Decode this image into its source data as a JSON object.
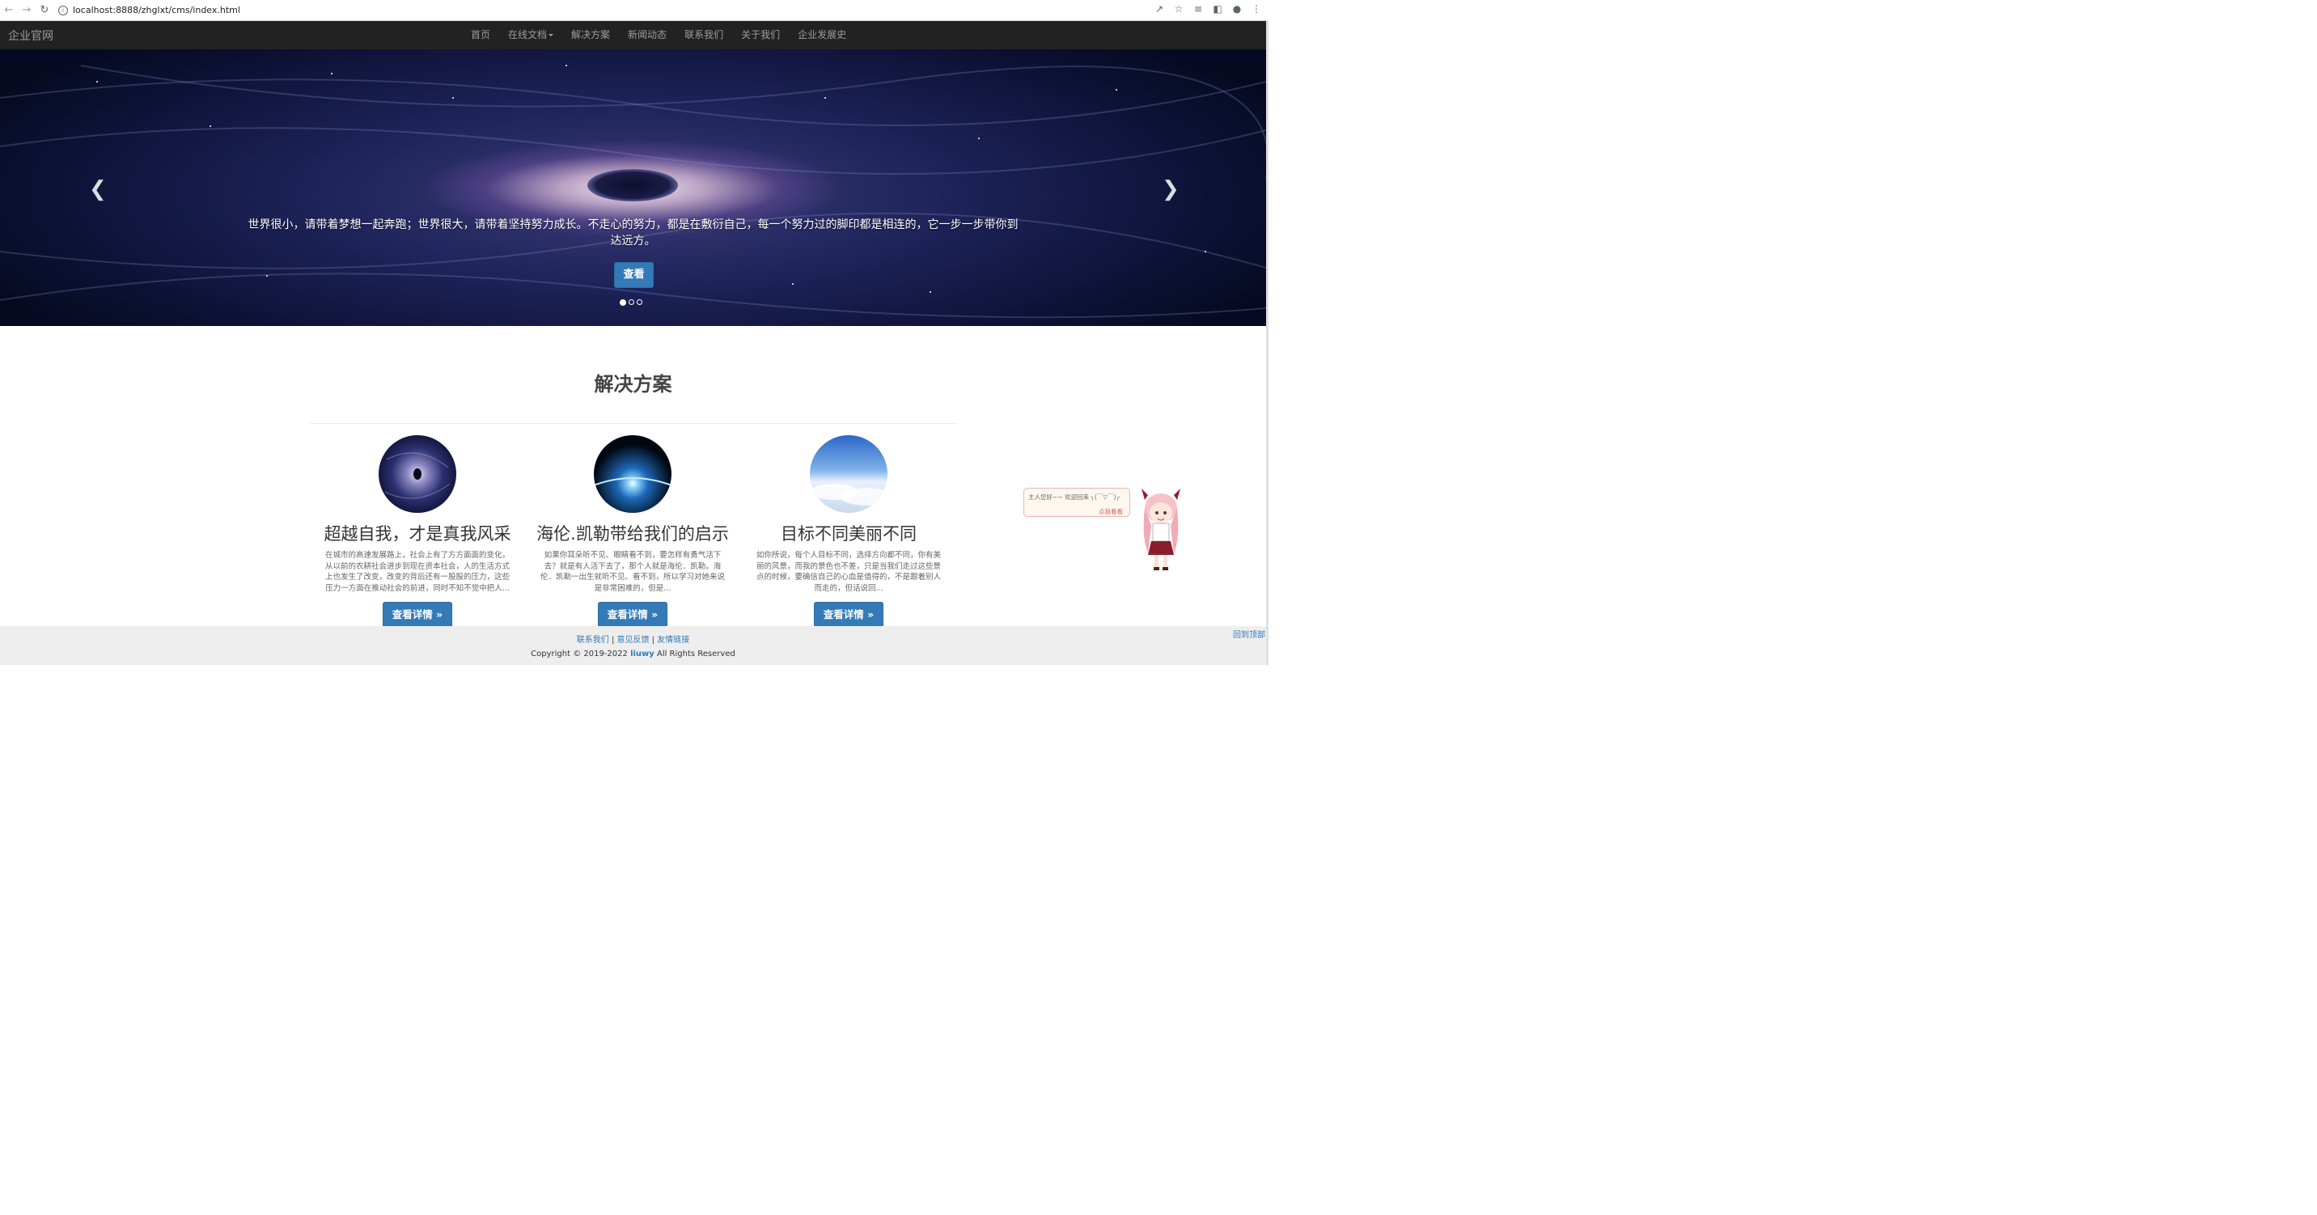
{
  "browser": {
    "url": "localhost:8888/zhglxt/cms/index.html"
  },
  "navbar": {
    "brand": "企业官网",
    "items": [
      {
        "label": "首页"
      },
      {
        "label": "在线文档"
      },
      {
        "label": "解决方案"
      },
      {
        "label": "新闻动态"
      },
      {
        "label": "联系我们"
      },
      {
        "label": "关于我们"
      },
      {
        "label": "企业发展史"
      }
    ]
  },
  "carousel": {
    "caption": "世界很小，请带着梦想一起奔跑；世界很大，请带着坚持努力成长。不走心的努力，都是在敷衍自己，每一个努力过的脚印都是相连的，它一步一步带你到达远方。",
    "button": "查看",
    "slide_count": 3,
    "active_slide": 1,
    "prev_icon": "chevron-left-icon",
    "next_icon": "chevron-right-icon"
  },
  "solutions": {
    "title": "解决方案",
    "cards": [
      {
        "title": "超越自我，才是真我风采",
        "text": "在城市的高速发展路上，社会上有了方方面面的变化，从以前的农耕社会进步到现在资本社会，人的生活方式上也发生了改变，改变的背后还有一股股的压力，这些压力一方面在推动社会的前进，同时不知不觉中把人...",
        "button": "查看详情 »"
      },
      {
        "title": "海伦.凯勒带给我们的启示",
        "text": "如果你耳朵听不见、眼睛看不到，要怎样有勇气活下去？就是有人活下去了，那个人就是海伦．凯勒。海伦．凯勒一出生就听不见、看不到，所以学习对她来说是非常困难的，但是...",
        "button": "查看详情 »"
      },
      {
        "title": "目标不同美丽不同",
        "text": "如你所说，每个人目标不同，选择方向都不同，你有美丽的风景，而我的景色也不差，只是当我们走过这些景点的时候，要确信自己的心血是值得的，不是跟着别人而走的，但话说回...",
        "button": "查看详情 »"
      }
    ]
  },
  "mascot": {
    "greeting": "主人您好~~ 欢迎回来 ╮(￣▽￣)╭",
    "link": "点我看看"
  },
  "footer": {
    "links": [
      "联系我们",
      "意见反馈",
      "友情链接"
    ],
    "separator": " | ",
    "copyright_prefix": "Copyright © 2019-2022 ",
    "author": "liuwy",
    "copyright_suffix": "  All Rights Reserved",
    "back_to_top": "回到顶部"
  },
  "colors": {
    "primary": "#337ab7",
    "navbar_bg": "#222222",
    "footer_bg": "#eeeeee"
  }
}
